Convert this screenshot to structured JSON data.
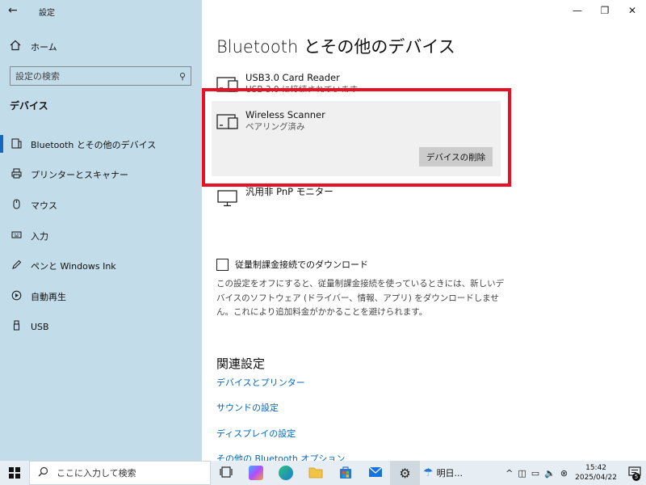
{
  "window": {
    "app_title": "設定",
    "controls": {
      "minimize": "—",
      "maximize": "❐",
      "close": "✕"
    }
  },
  "sidebar": {
    "home_label": "ホーム",
    "search_placeholder": "設定の検索",
    "section_title": "デバイス",
    "items": [
      {
        "label": "Bluetooth とその他のデバイス",
        "icon": "bluetooth-devices-icon",
        "active": true
      },
      {
        "label": "プリンターとスキャナー",
        "icon": "printer-icon"
      },
      {
        "label": "マウス",
        "icon": "mouse-icon"
      },
      {
        "label": "入力",
        "icon": "keyboard-icon"
      },
      {
        "label": "ペンと Windows Ink",
        "icon": "pen-icon"
      },
      {
        "label": "自動再生",
        "icon": "autoplay-icon"
      },
      {
        "label": "USB",
        "icon": "usb-icon"
      }
    ]
  },
  "main": {
    "title": "Bluetooth とその他のデバイス",
    "devices": [
      {
        "name": "USB3.0 Card Reader",
        "status": "USB 3.0 に接続されています"
      },
      {
        "name": "Wireless Scanner",
        "status": "ペアリング済み",
        "selected": true
      },
      {
        "name": "汎用非 PnP モニター",
        "status": ""
      }
    ],
    "remove_button": "デバイスの削除",
    "metered": {
      "label": "従量制課金接続でのダウンロード",
      "checked": false,
      "description": "この設定をオフにすると、従量制課金接続を使っているときには、新しいデバイスのソフトウェア (ドライバー、情報、アプリ) をダウンロードしません。これにより追加料金がかかることを避けられます。"
    },
    "related": {
      "title": "関連設定",
      "links": [
        "デバイスとプリンター",
        "サウンドの設定",
        "ディスプレイの設定",
        "その他の Bluetooth オプション"
      ]
    }
  },
  "highlight_color": "#e81123",
  "taskbar": {
    "search_text": "ここに入力して検索",
    "weather_text": "明日...",
    "time": "15:42",
    "date": "2025/04/22",
    "notification_count": "5"
  }
}
